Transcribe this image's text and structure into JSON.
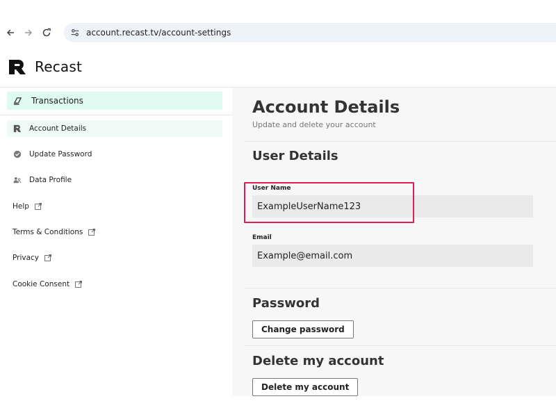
{
  "browser": {
    "url": "account.recast.tv/account-settings",
    "icons": [
      "back-arrow-icon",
      "forward-arrow-icon",
      "reload-icon",
      "site-settings-icon"
    ]
  },
  "app": {
    "brand": "Recast"
  },
  "sidebar": {
    "top_item": {
      "label": "Transactions",
      "icon": "transactions-icon"
    },
    "items": [
      {
        "label": "Account Details",
        "icon": "recast-r-icon",
        "active": true
      },
      {
        "label": "Update Password",
        "icon": "check-circle-icon",
        "active": false
      },
      {
        "label": "Data Profile",
        "icon": "users-icon",
        "active": false
      }
    ],
    "links": [
      {
        "label": "Help",
        "icon": "external-link-icon"
      },
      {
        "label": "Terms & Conditions",
        "icon": "external-link-icon"
      },
      {
        "label": "Privacy",
        "icon": "external-link-icon"
      },
      {
        "label": "Cookie Consent",
        "icon": "external-link-icon"
      }
    ]
  },
  "main": {
    "title": "Account Details",
    "subtitle": "Update and delete your account",
    "user_details": {
      "title": "User Details",
      "username_label": "User Name",
      "username_value": "ExampleUserName123",
      "email_label": "Email",
      "email_value": "Example@email.com"
    },
    "password": {
      "title": "Password",
      "button": "Change password"
    },
    "delete": {
      "title": "Delete my account",
      "button": "Delete my account"
    }
  },
  "colors": {
    "accent_mint": "#dffaf1",
    "highlight": "#e01e54",
    "main_bg": "#f7f7f7"
  }
}
